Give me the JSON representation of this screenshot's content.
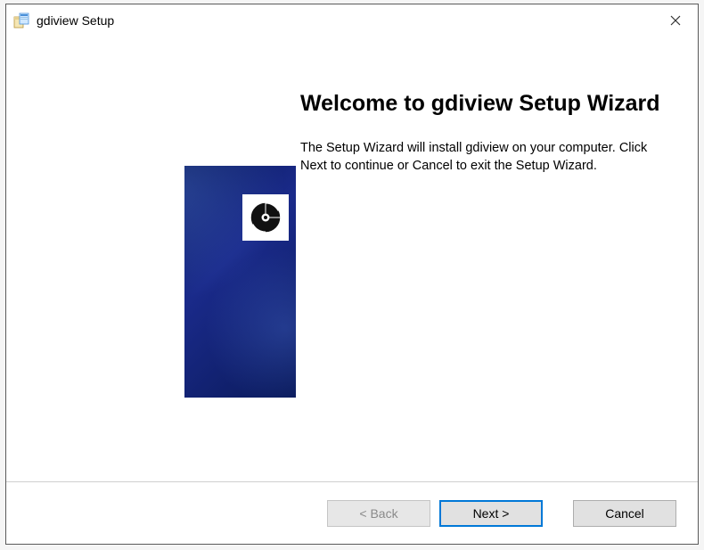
{
  "window": {
    "title": "gdiview Setup"
  },
  "wizard": {
    "heading": "Welcome to gdiview Setup Wizard",
    "body": "The Setup Wizard will install gdiview on your computer.  Click Next to continue or Cancel to exit the Setup Wizard."
  },
  "buttons": {
    "back": "< Back",
    "next": "Next >",
    "cancel": "Cancel"
  },
  "icons": {
    "installer": "installer-box-icon",
    "close": "close-icon",
    "cd": "cd-icon"
  }
}
